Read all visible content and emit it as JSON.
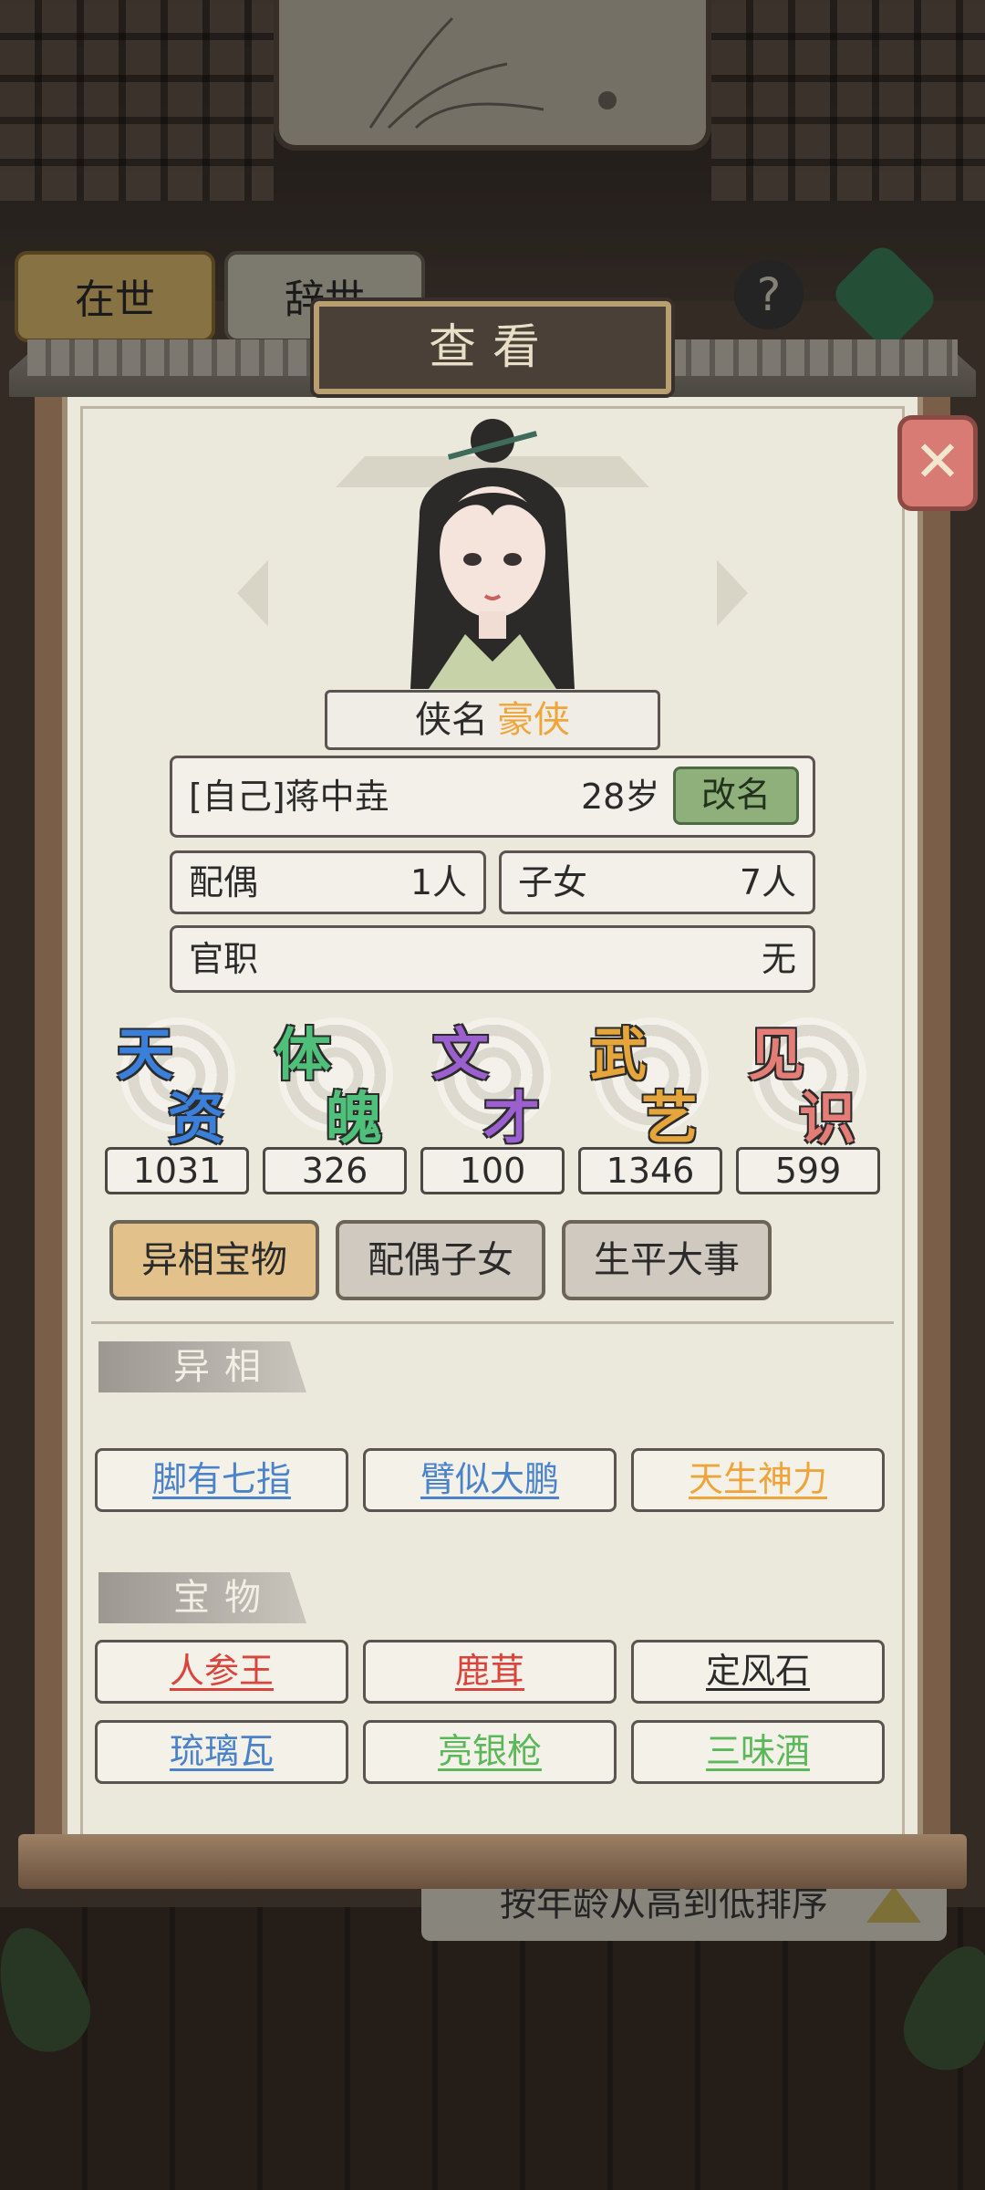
{
  "background": {
    "tabs": [
      {
        "label": "在世"
      },
      {
        "label": "辞世"
      }
    ],
    "help": "?",
    "sort_label": "按年龄从高到低排序"
  },
  "dialog": {
    "title": "查看",
    "close": "✕"
  },
  "hero": {
    "title_label": "侠名",
    "title_value": "豪侠",
    "name": "[自己]蒋中垚",
    "age": "28岁",
    "rename_label": "改名",
    "spouse_label": "配偶",
    "spouse_value": "1人",
    "children_label": "子女",
    "children_value": "7人",
    "office_label": "官职",
    "office_value": "无"
  },
  "attributes": [
    {
      "c1": "天",
      "c2": "资",
      "value": "1031",
      "color": "#3a7fd9"
    },
    {
      "c1": "体",
      "c2": "魄",
      "value": "326",
      "color": "#4fc07a"
    },
    {
      "c1": "文",
      "c2": "才",
      "value": "100",
      "color": "#9b5fd0"
    },
    {
      "c1": "武",
      "c2": "艺",
      "value": "1346",
      "color": "#e6a53a"
    },
    {
      "c1": "见",
      "c2": "识",
      "value": "599",
      "color": "#e37d76"
    }
  ],
  "tabs": [
    {
      "label": "异相宝物",
      "active": true
    },
    {
      "label": "配偶子女",
      "active": false
    },
    {
      "label": "生平大事",
      "active": false
    }
  ],
  "traits_section": {
    "title": "异相",
    "items": [
      {
        "label": "脚有七指",
        "color": "#4a83c9"
      },
      {
        "label": "臂似大鹏",
        "color": "#4a83c9"
      },
      {
        "label": "天生神力",
        "color": "#efa43a"
      }
    ]
  },
  "treasures_section": {
    "title": "宝物",
    "items": [
      {
        "label": "人参王",
        "color": "#d9453c"
      },
      {
        "label": "鹿茸",
        "color": "#d9453c"
      },
      {
        "label": "定风石",
        "color": "#2b2b2b"
      },
      {
        "label": "琉璃瓦",
        "color": "#4a83c9"
      },
      {
        "label": "亮银枪",
        "color": "#5ab85a"
      },
      {
        "label": "三味酒",
        "color": "#5ab85a"
      }
    ]
  }
}
